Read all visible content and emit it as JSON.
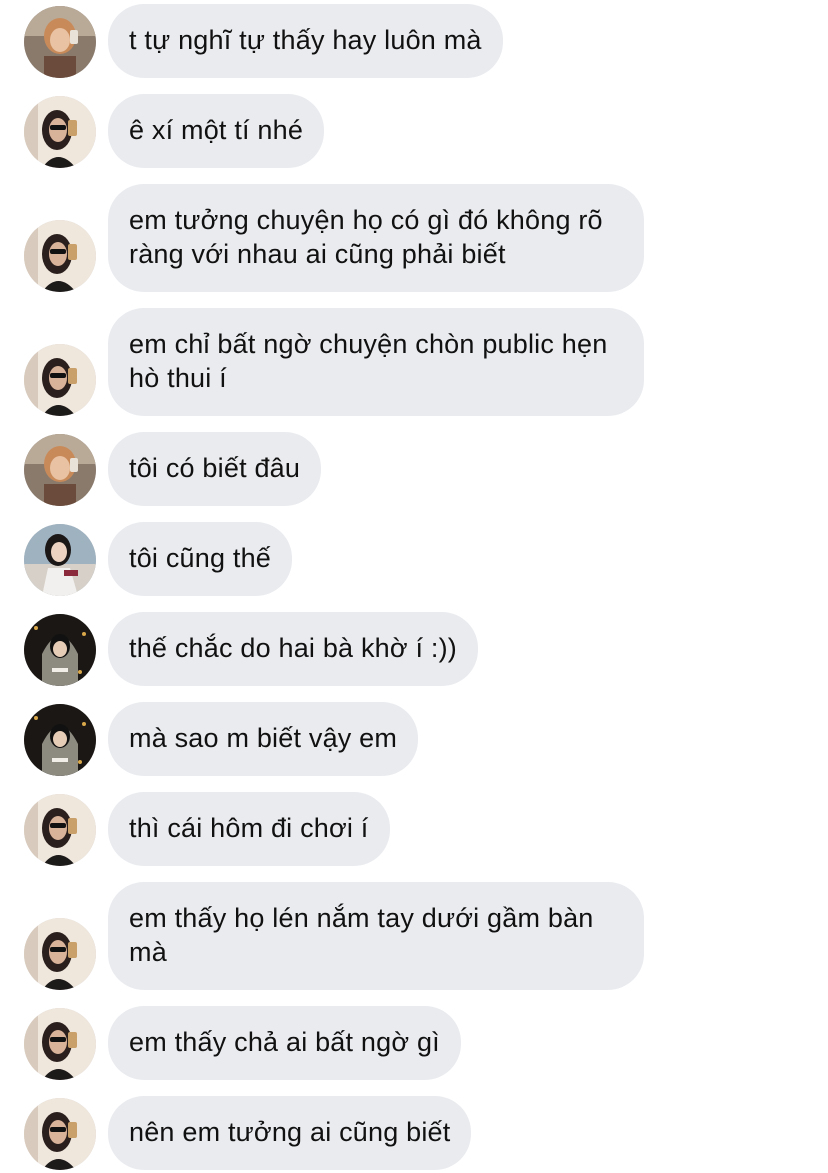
{
  "messages": [
    {
      "text": "t tự nghĩ tự thấy hay luôn mà",
      "avatar": "warm-selfie-avatar"
    },
    {
      "text": "ê xí một tí nhé",
      "avatar": "sunglasses-selfie-avatar"
    },
    {
      "text": "em tưởng chuyện họ có gì đó không rõ ràng với nhau ai cũng phải biết",
      "avatar": "sunglasses-selfie-avatar"
    },
    {
      "text": "em chỉ bất ngờ chuyện chòn public hẹn hò thui í",
      "avatar": "sunglasses-selfie-avatar"
    },
    {
      "text": "tôi có biết đâu",
      "avatar": "warm-selfie-avatar"
    },
    {
      "text": "tôi cũng thế",
      "avatar": "seated-girl-avatar"
    },
    {
      "text": "thế chắc do hai bà khờ í :))",
      "avatar": "hooded-girl-avatar"
    },
    {
      "text": "mà sao m biết vậy em",
      "avatar": "hooded-girl-avatar"
    },
    {
      "text": "thì cái hôm đi chơi í",
      "avatar": "sunglasses-selfie-avatar"
    },
    {
      "text": "em thấy họ lén nắm tay dưới gầm bàn mà",
      "avatar": "sunglasses-selfie-avatar"
    },
    {
      "text": "em thấy chả ai bất ngờ gì",
      "avatar": "sunglasses-selfie-avatar"
    },
    {
      "text": "nên em tưởng ai cũng biết",
      "avatar": "sunglasses-selfie-avatar"
    }
  ],
  "colors": {
    "bubble": "#e9ebef",
    "text": "#111111",
    "background": "#ffffff"
  }
}
